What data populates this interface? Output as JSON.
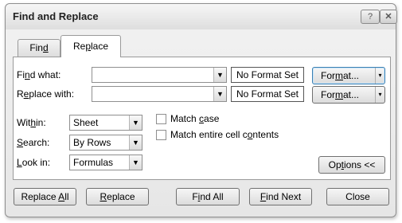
{
  "window": {
    "title": "Find and Replace",
    "help_glyph": "?",
    "close_glyph": "✕"
  },
  "tabs": [
    {
      "label_pre": "Fin",
      "label_key": "d",
      "label_post": ""
    },
    {
      "label_pre": "Re",
      "label_key": "p",
      "label_post": "lace"
    }
  ],
  "find_row": {
    "label_pre": "Fi",
    "label_key": "n",
    "label_post": "d what:",
    "value": "",
    "format_status": "No Format Set",
    "format_btn_pre": "For",
    "format_btn_key": "m",
    "format_btn_post": "at...",
    "arrow": "▾"
  },
  "replace_row": {
    "label_pre": "R",
    "label_key": "e",
    "label_post": "place with:",
    "value": "",
    "format_status": "No Format Set",
    "format_btn_pre": "For",
    "format_btn_key": "m",
    "format_btn_post": "at...",
    "arrow": "▾"
  },
  "options": {
    "within": {
      "label_pre": "Wit",
      "label_key": "h",
      "label_post": "in:",
      "value": "Sheet"
    },
    "search": {
      "label_pre": "",
      "label_key": "S",
      "label_post": "earch:",
      "value": "By Rows"
    },
    "lookin": {
      "label_pre": "",
      "label_key": "L",
      "label_post": "ook in:",
      "value": "Formulas"
    },
    "match_case": {
      "label_pre": "Match ",
      "label_key": "c",
      "label_post": "ase",
      "checked": false
    },
    "match_entire": {
      "label_pre": "Match entire cell c",
      "label_key": "o",
      "label_post": "ntents",
      "checked": false
    },
    "options_btn": {
      "label_pre": "Op",
      "label_key": "t",
      "label_post": "ions <<"
    },
    "dropdown_glyph": "▼"
  },
  "footer": {
    "replace_all": {
      "pre": "Replace ",
      "key": "A",
      "post": "ll"
    },
    "replace": {
      "pre": "",
      "key": "R",
      "post": "eplace"
    },
    "find_all": {
      "pre": "F",
      "key": "i",
      "post": "nd All"
    },
    "find_next": {
      "pre": "",
      "key": "F",
      "post": "ind Next"
    },
    "close": {
      "label": "Close"
    }
  }
}
